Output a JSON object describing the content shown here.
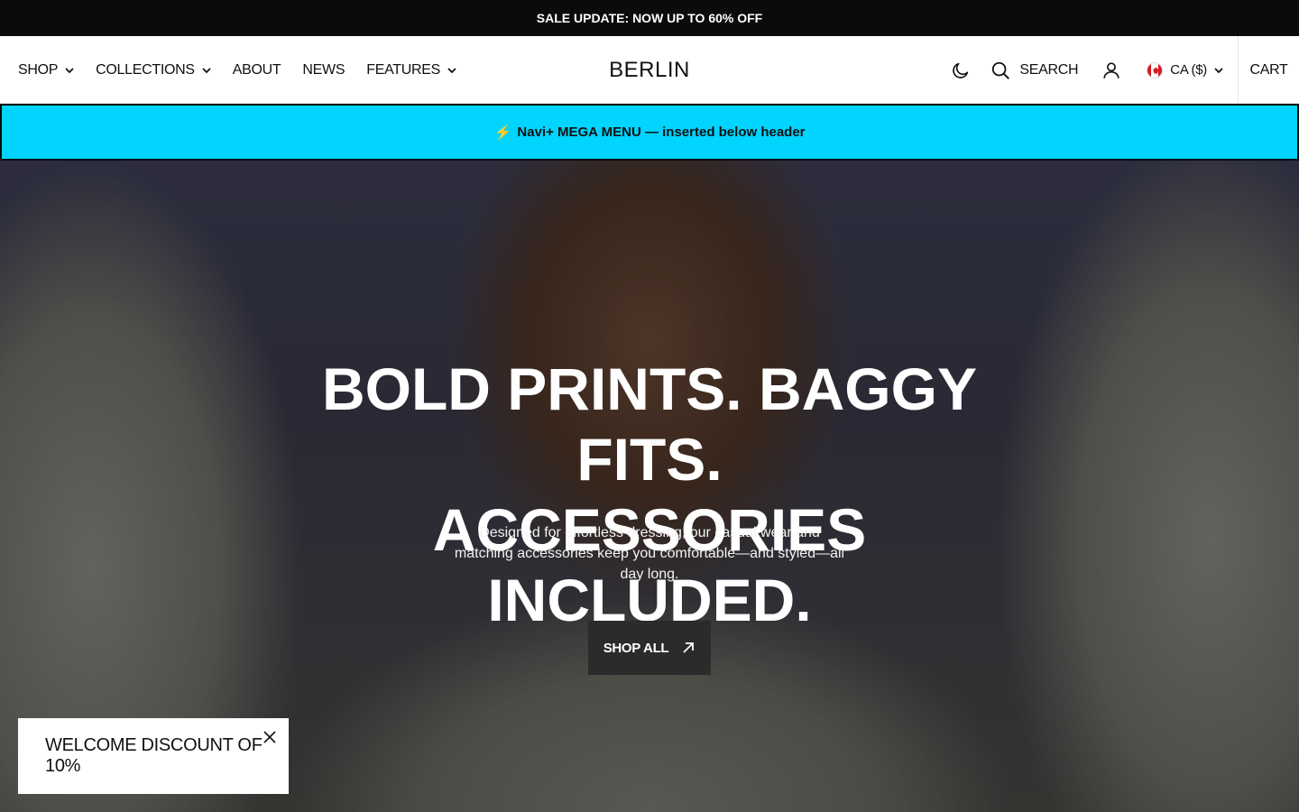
{
  "announcement": {
    "text": "SALE UPDATE: NOW UP TO 60% OFF"
  },
  "header": {
    "nav_left": [
      {
        "label": "SHOP",
        "has_dropdown": true
      },
      {
        "label": "COLLECTIONS",
        "has_dropdown": true
      },
      {
        "label": "ABOUT",
        "has_dropdown": false
      },
      {
        "label": "NEWS",
        "has_dropdown": false
      },
      {
        "label": "FEATURES",
        "has_dropdown": true
      }
    ],
    "brand": "BERLIN",
    "theme_icon": "moon-icon",
    "search_label": "SEARCH",
    "search_icon": "search-icon",
    "account_icon": "user-icon",
    "currency_label": "CA ($)",
    "currency_flag": "canada-flag-icon",
    "cart_label": "CART"
  },
  "mega_banner": {
    "icon": "lightning-icon",
    "text": "Navi+ MEGA MENU — inserted below header",
    "bg_color": "#00d4ff"
  },
  "hero": {
    "title_line1": "BOLD PRINTS. BAGGY FITS.",
    "title_line2": "ACCESSORIES INCLUDED.",
    "subtitle": "Designed for effortless dressing, our casual wear and matching accessories keep you comfortable—and styled—all day long.",
    "button_label": "SHOP ALL",
    "button_icon": "arrow-up-right-icon"
  },
  "popup": {
    "text": "WELCOME DISCOUNT OF 10%",
    "close_icon": "close-icon"
  }
}
